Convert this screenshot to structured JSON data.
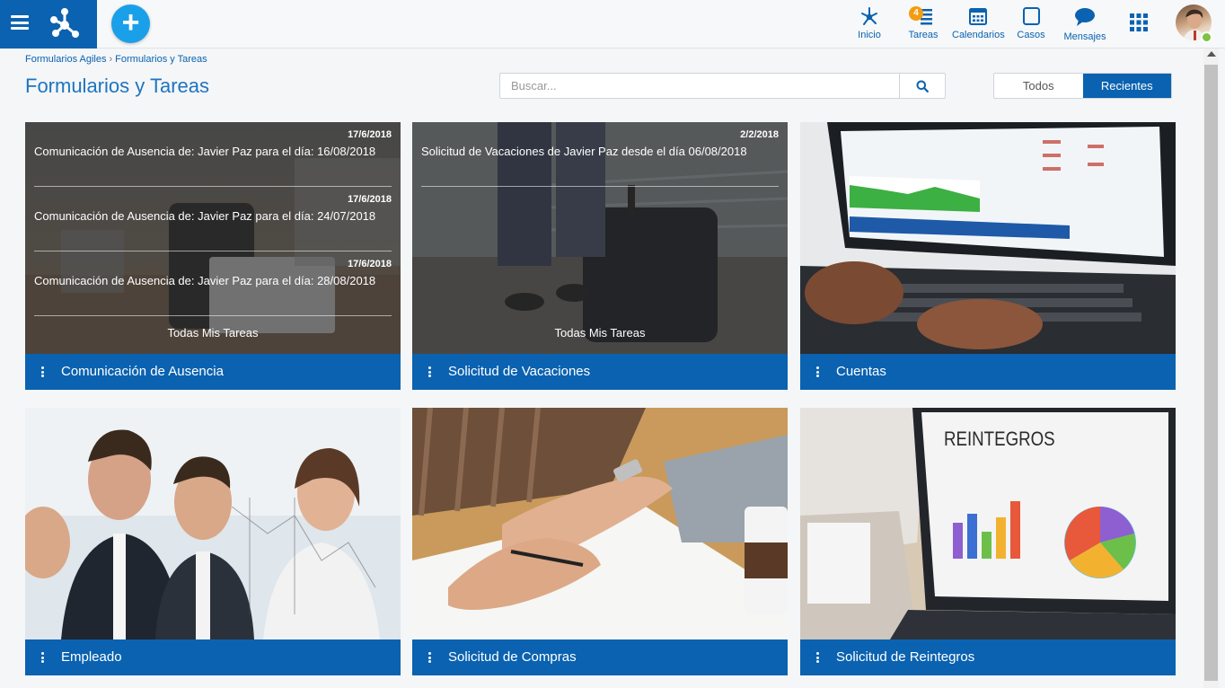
{
  "topbar": {
    "nav": [
      {
        "label": "Inicio",
        "icon": "network-home-icon"
      },
      {
        "label": "Tareas",
        "icon": "tasks-icon",
        "badge": "4"
      },
      {
        "label": "Calendarios",
        "icon": "calendar-icon"
      },
      {
        "label": "Casos",
        "icon": "cases-icon"
      },
      {
        "label": "Mensajes",
        "icon": "chat-icon"
      }
    ],
    "add_label": "+",
    "accent": "#0a62b0",
    "add_color": "#1aa0e8"
  },
  "breadcrumb": [
    "Formularios Agiles",
    "Formularios y Tareas"
  ],
  "page_title": "Formularios y Tareas",
  "search": {
    "placeholder": "Buscar..."
  },
  "filter": {
    "todos": "Todos",
    "recientes": "Recientes",
    "active": "Recientes"
  },
  "cards": [
    {
      "title": "Comunicación de Ausencia",
      "tasks": [
        {
          "date": "17/6/2018",
          "text": "Comunicación de Ausencia de: Javier Paz para el día: 16/08/2018"
        },
        {
          "date": "17/6/2018",
          "text": "Comunicación de Ausencia de: Javier Paz para el día: 24/07/2018"
        },
        {
          "date": "17/6/2018",
          "text": "Comunicación de Ausencia de: Javier Paz para el día: 28/08/2018"
        }
      ],
      "all_link": "Todas Mis Tareas"
    },
    {
      "title": "Solicitud de Vacaciones",
      "tasks": [
        {
          "date": "2/2/2018",
          "text": "Solicitud de Vacaciones de Javier  Paz desde el día 06/08/2018"
        }
      ],
      "all_link": "Todas Mis Tareas"
    },
    {
      "title": "Cuentas"
    },
    {
      "title": "Empleado"
    },
    {
      "title": "Solicitud de Compras"
    },
    {
      "title": "Solicitud de Reintegros",
      "image_text": "REINTEGROS"
    }
  ]
}
